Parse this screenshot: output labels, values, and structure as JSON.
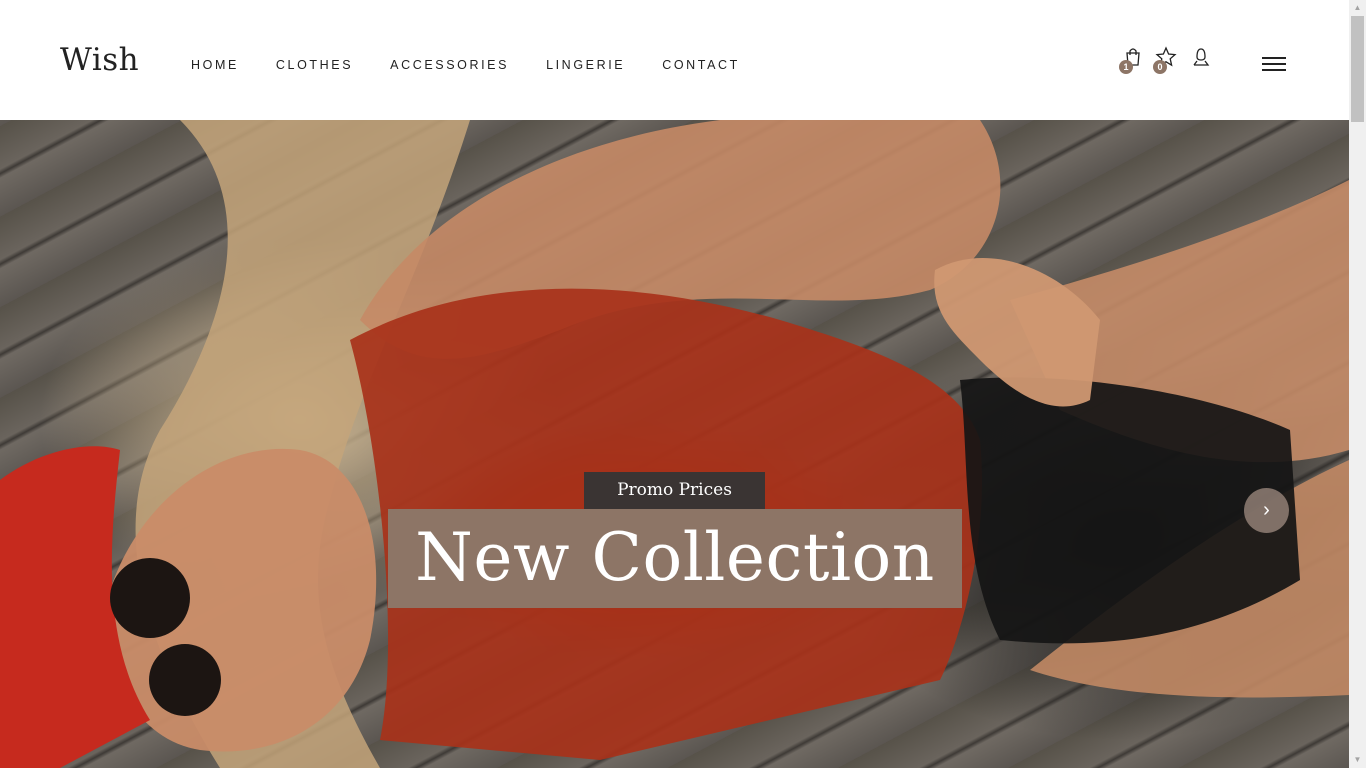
{
  "header": {
    "logo": "Wish",
    "nav": [
      {
        "label": "HOME"
      },
      {
        "label": "CLOTHES"
      },
      {
        "label": "ACCESSORIES"
      },
      {
        "label": "LINGERIE"
      },
      {
        "label": "CONTACT"
      }
    ],
    "icons": {
      "cart": {
        "icon": "shopping-bag-icon",
        "count": "1"
      },
      "wishlist": {
        "icon": "star-icon",
        "count": "0"
      },
      "account": {
        "icon": "user-icon"
      },
      "menu": {
        "icon": "hamburger-menu-icon"
      }
    }
  },
  "hero": {
    "promo": "Promo Prices",
    "title": "New Collection",
    "next": "›"
  },
  "colors": {
    "accent": "#8d7566",
    "promo_bg": "#3a3433",
    "text": "#222222"
  }
}
